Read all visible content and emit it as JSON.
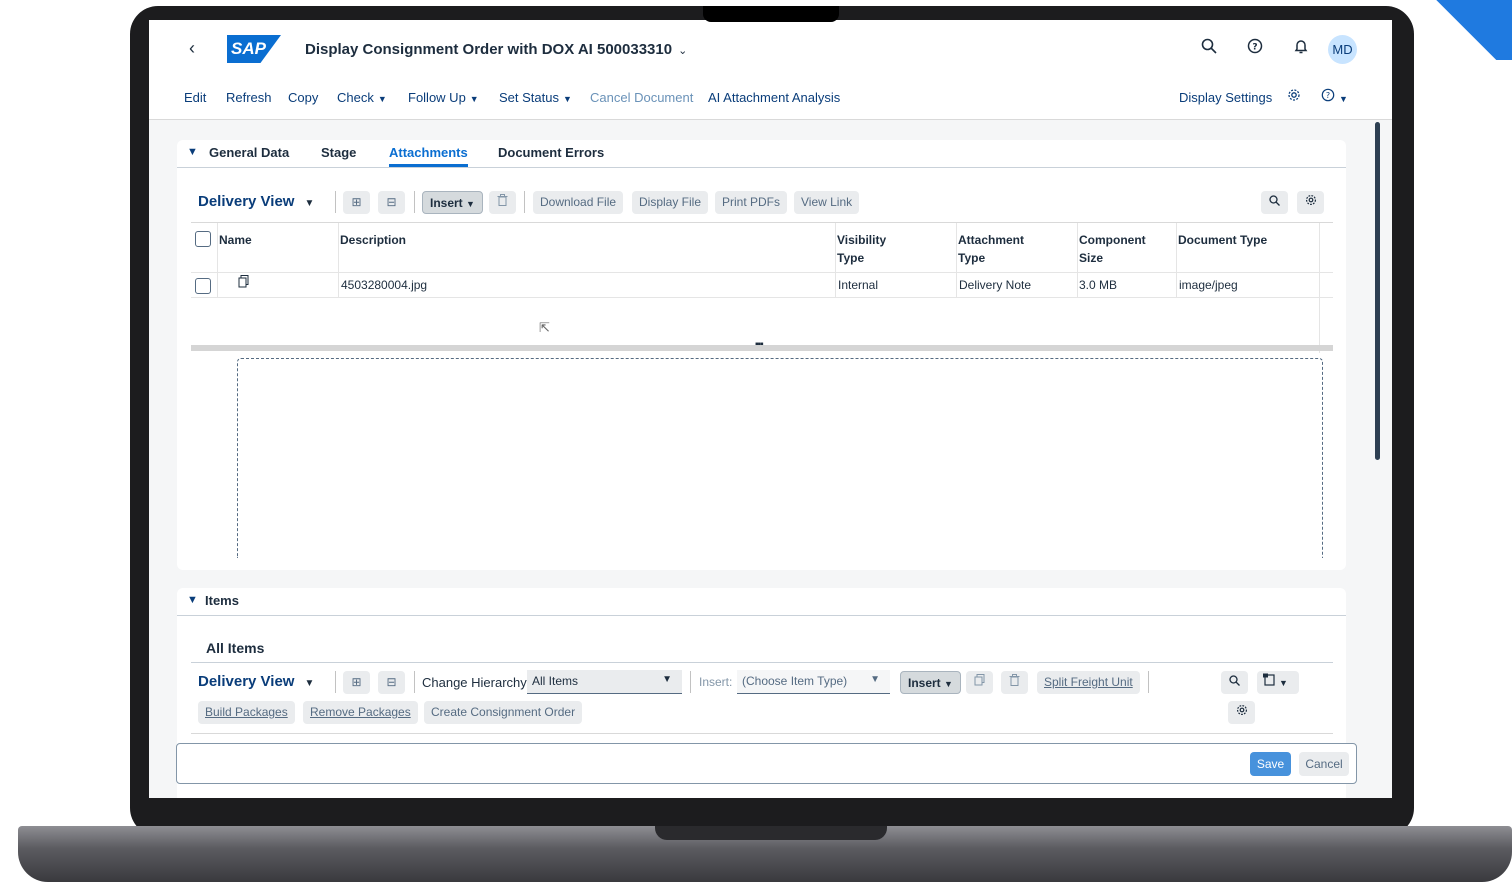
{
  "header": {
    "back_icon": "‹",
    "logo_text": "SAP",
    "title": "Display Consignment Order with DOX AI 500033310",
    "title_chevron": "⌄",
    "avatar": "MD"
  },
  "toolbar": {
    "edit": "Edit",
    "refresh": "Refresh",
    "copy": "Copy",
    "check": "Check",
    "follow_up": "Follow Up",
    "set_status": "Set Status",
    "cancel_document": "Cancel Document",
    "ai_attachment_analysis": "AI Attachment Analysis",
    "display_settings": "Display Settings"
  },
  "tabs": {
    "general_data": "General Data",
    "stage": "Stage",
    "attachments": "Attachments",
    "document_errors": "Document Errors"
  },
  "attachments": {
    "view": "Delivery View",
    "insert": "Insert",
    "download_file": "Download File",
    "display_file": "Display File",
    "print_pdfs": "Print PDFs",
    "view_link": "View Link",
    "columns": {
      "name": "Name",
      "description": "Description",
      "visibility_1": "Visibility",
      "visibility_2": "Type",
      "attachment_1": "Attachment",
      "attachment_2": "Type",
      "component_1": "Component",
      "component_2": "Size",
      "document_type": "Document Type"
    },
    "row": {
      "description": "4503280004.jpg",
      "visibility_type": "Internal",
      "attachment_type": "Delivery Note",
      "component_size": "3.0 MB",
      "document_type": "image/jpeg"
    }
  },
  "items": {
    "section_title": "Items",
    "subtitle": "All Items",
    "view": "Delivery View",
    "change_hierarchy_label": "Change Hierarchy:",
    "change_hierarchy_value": "All Items",
    "insert_label": "Insert:",
    "insert_placeholder": "(Choose Item Type)",
    "insert": "Insert",
    "split_freight_unit": "Split Freight Unit",
    "build_packages": "Build Packages",
    "remove_packages": "Remove Packages",
    "create_consignment_order": "Create Consignment Order"
  },
  "footer": {
    "save": "Save",
    "cancel": "Cancel"
  },
  "colors": {
    "brand": "#0a6ed1",
    "link": "#0a3d7a",
    "corner_accent": "#1f7ae0"
  }
}
